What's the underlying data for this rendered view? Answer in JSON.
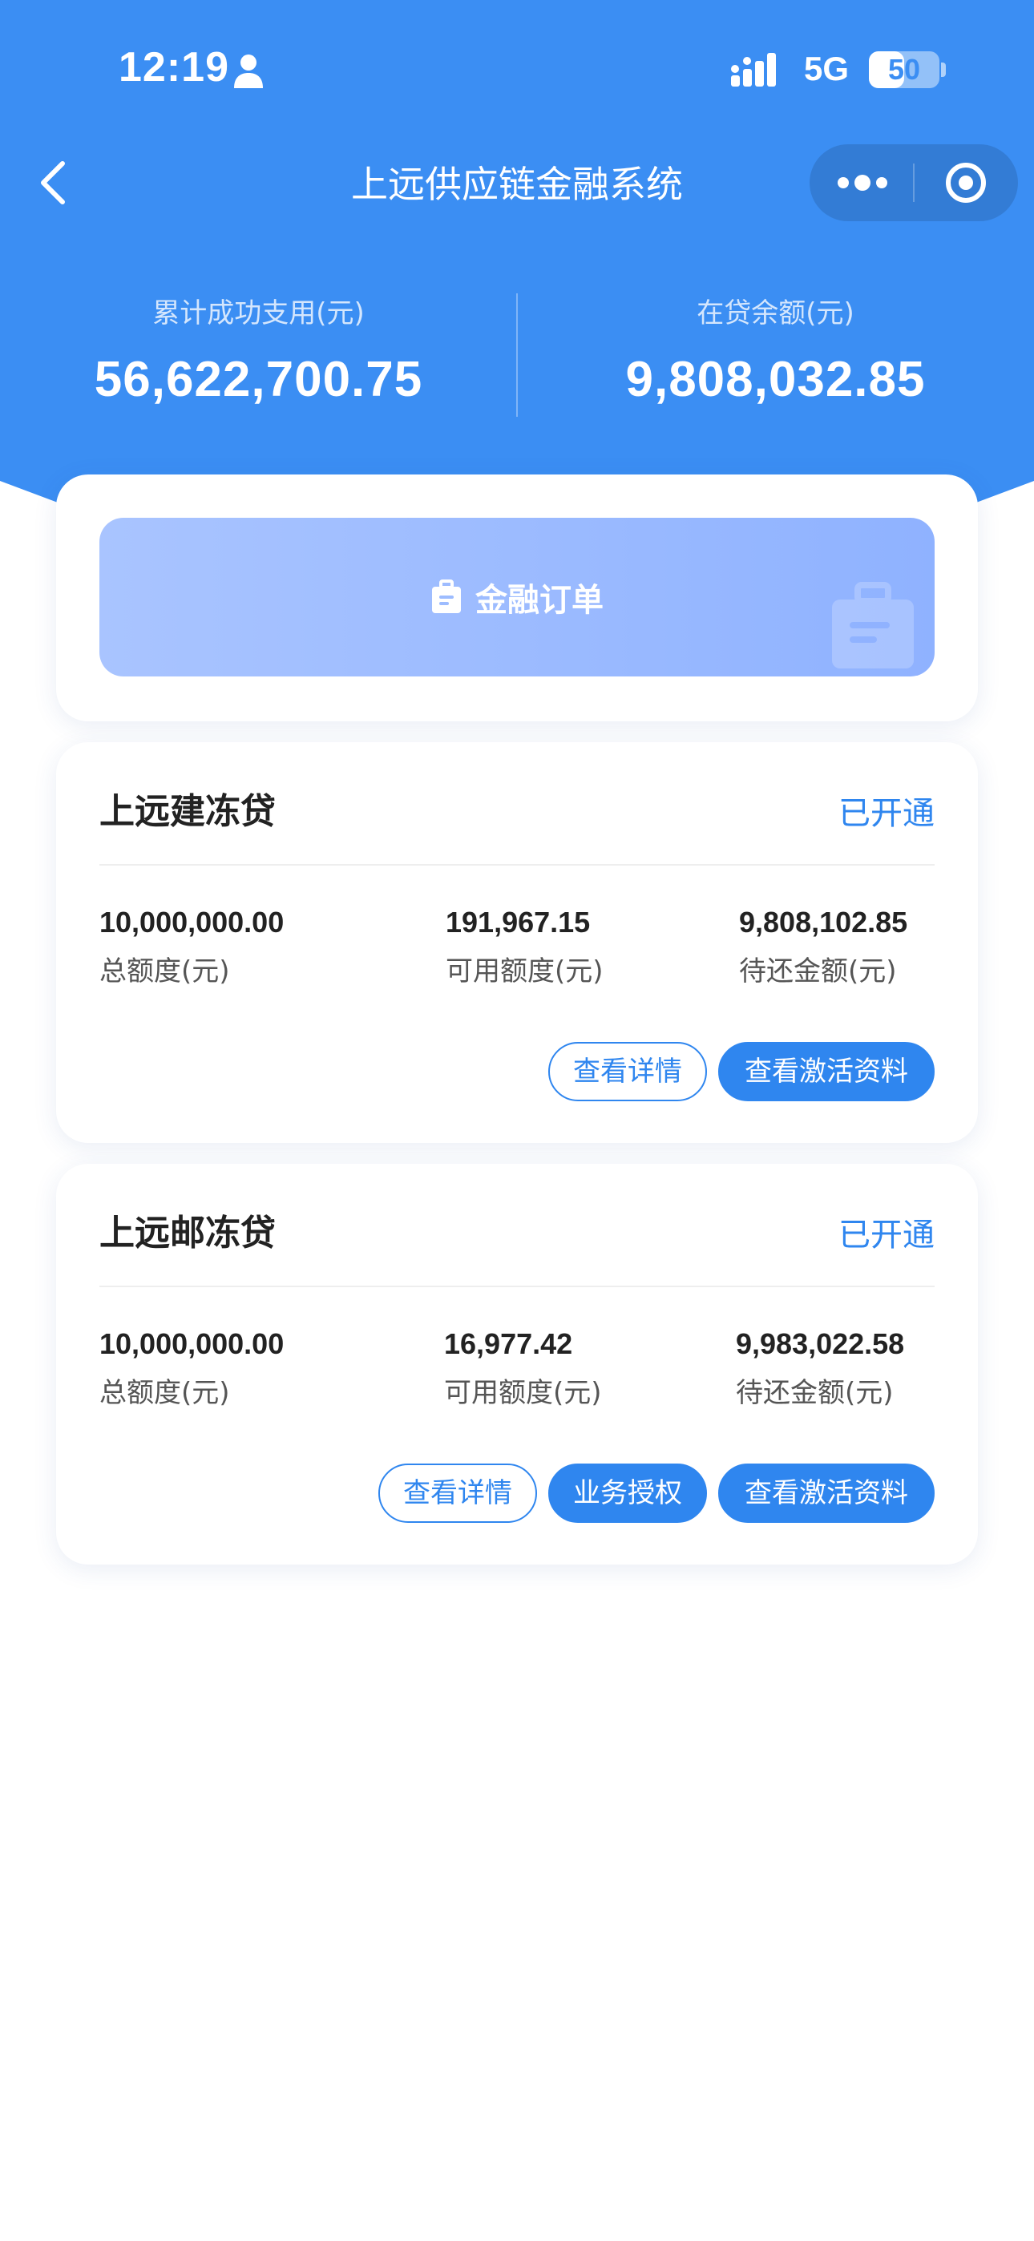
{
  "status_bar": {
    "time": "12:19",
    "network": "5G",
    "battery": "50",
    "battery_level_percent": 50,
    "icons": [
      "person-icon",
      "signal-icon",
      "battery-icon"
    ]
  },
  "nav": {
    "title": "上远供应链金融系统",
    "back_icon": "chevron-left-icon",
    "more_icon": "more-dots-icon",
    "close_icon": "target-circle-icon"
  },
  "stats": {
    "total_label": "累计成功支用(元)",
    "total_value": "56,622,700.75",
    "balance_label": "在贷余额(元)",
    "balance_value": "9,808,032.85"
  },
  "order": {
    "label": "金融订单",
    "icon": "briefcase-icon"
  },
  "loans": [
    {
      "title": "上远建冻贷",
      "status": "已开通",
      "metrics": [
        {
          "value": "10,000,000.00",
          "label": "总额度(元)"
        },
        {
          "value": "191,967.15",
          "label": "可用额度(元)"
        },
        {
          "value": "9,808,102.85",
          "label": "待还金额(元)"
        }
      ],
      "buttons": {
        "detail": "查看详情",
        "activation": "查看激活资料"
      }
    },
    {
      "title": "上远邮冻贷",
      "status": "已开通",
      "metrics": [
        {
          "value": "10,000,000.00",
          "label": "总额度(元)"
        },
        {
          "value": "16,977.42",
          "label": "可用额度(元)"
        },
        {
          "value": "9,983,022.58",
          "label": "待还金额(元)"
        }
      ],
      "buttons": {
        "detail": "查看详情",
        "authorize": "业务授权",
        "activation": "查看激活资料"
      }
    }
  ],
  "colors": {
    "primary": "#3b8ef3",
    "accent_text": "#2f86ef",
    "order_gradient_start": "#a9c4ff",
    "order_gradient_end": "#8fb2ff"
  }
}
